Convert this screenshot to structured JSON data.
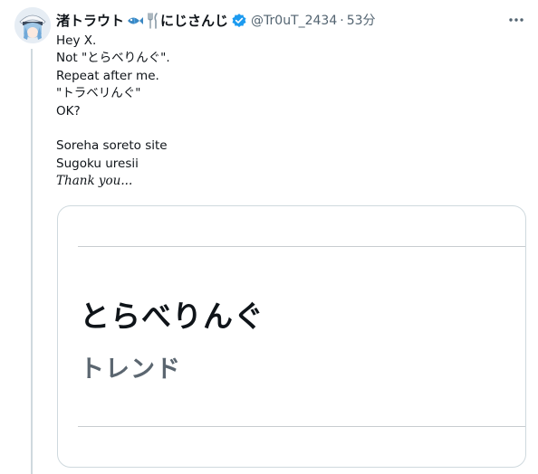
{
  "tweet": {
    "author": {
      "display_name": "渚トラウト",
      "display_name_suffix": "にじさんじ",
      "handle": "@Tr0uT_2434",
      "verified": true,
      "avatar_icon": "avatar-icon",
      "emojis": [
        "fish-icon",
        "fork-knife-icon"
      ]
    },
    "separator": "·",
    "time": "53分",
    "lines": [
      "Hey X.",
      "Not \"とらべりんぐ\".",
      "Repeat after me.",
      "\"トラベリんぐ\"",
      "OK?",
      "",
      "Soreha soreto site",
      "Sugoku uresii",
      "Thank you..."
    ],
    "media": {
      "title": "とらべりんぐ",
      "subtitle": "トレンド"
    }
  },
  "colors": {
    "text": "#0f1419",
    "secondary": "#536471",
    "verified": "#1d9bf0",
    "border": "#cfd9de",
    "trend_text": "#5b6670"
  }
}
